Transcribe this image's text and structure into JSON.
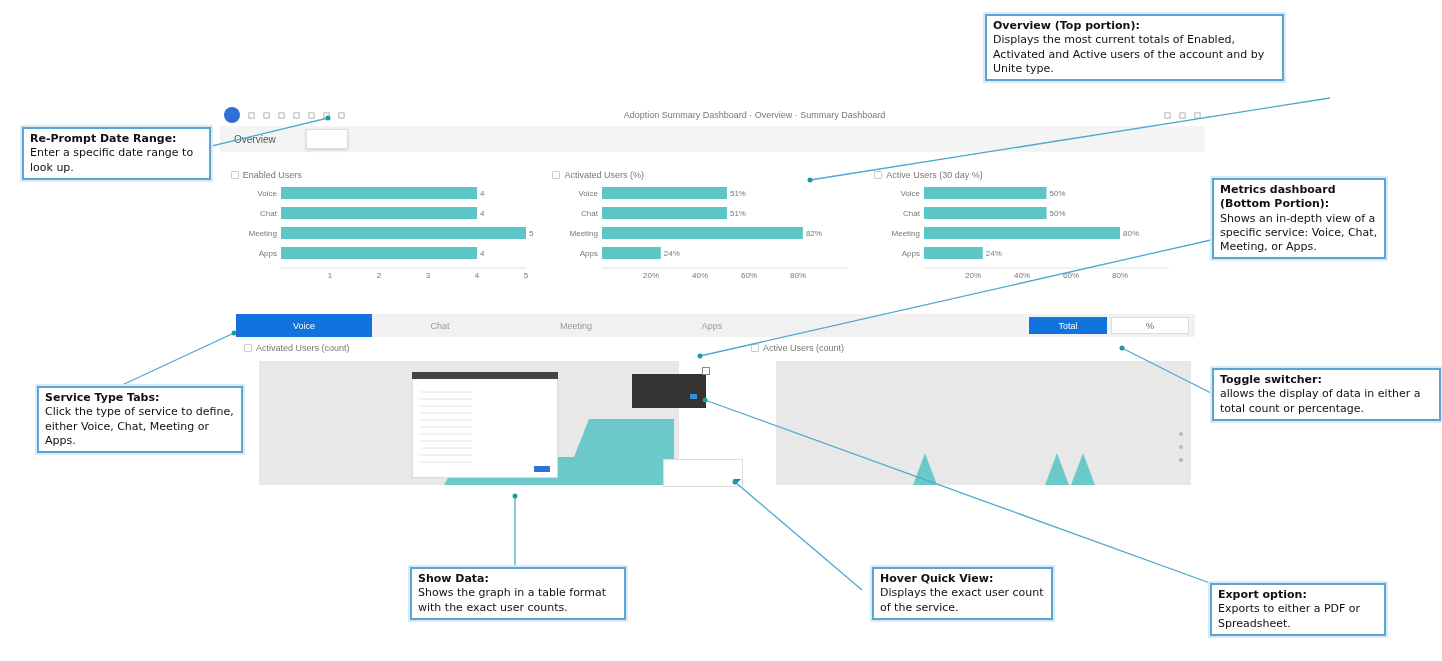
{
  "toolbar": {
    "title": "Adoption Summary Dashboard · Overview · Summary Dashboard"
  },
  "header": {
    "title": "Overview"
  },
  "overview_charts": [
    {
      "chart_data": {
        "type": "bar",
        "orientation": "horizontal",
        "title": "Enabled Users",
        "categories": [
          "Voice",
          "Chat",
          "Meeting",
          "Apps"
        ],
        "values": [
          4,
          4,
          5,
          4
        ],
        "xlim": [
          0,
          5
        ],
        "xticks": [
          1,
          2,
          3,
          4,
          5
        ],
        "data_labels": true
      }
    },
    {
      "chart_data": {
        "type": "bar",
        "orientation": "horizontal",
        "title": "Activated Users (%)",
        "categories": [
          "Voice",
          "Chat",
          "Meeting",
          "Apps"
        ],
        "values": [
          51,
          51,
          82,
          24
        ],
        "xlim": [
          0,
          100
        ],
        "xticks": [
          {
            "value": 20,
            "label": "20%"
          },
          {
            "value": 40,
            "label": "40%"
          },
          {
            "value": 60,
            "label": "60%"
          },
          {
            "value": 80,
            "label": "80%"
          }
        ],
        "value_labels": [
          "51%",
          "51%",
          "82%",
          "24%"
        ]
      }
    },
    {
      "chart_data": {
        "type": "bar",
        "orientation": "horizontal",
        "title": "Active Users (30 day %)",
        "categories": [
          "Voice",
          "Chat",
          "Meeting",
          "Apps"
        ],
        "values": [
          50,
          50,
          80,
          24
        ],
        "xlim": [
          0,
          100
        ],
        "xticks": [
          {
            "value": 20,
            "label": "20%"
          },
          {
            "value": 40,
            "label": "40%"
          },
          {
            "value": 60,
            "label": "60%"
          },
          {
            "value": 80,
            "label": "80%"
          }
        ],
        "value_labels": [
          "50%",
          "50%",
          "80%",
          "24%"
        ]
      }
    }
  ],
  "service_tabs": [
    {
      "label": "Voice",
      "selected": true
    },
    {
      "label": "Chat",
      "selected": false
    },
    {
      "label": "Meeting",
      "selected": false
    },
    {
      "label": "Apps",
      "selected": false
    }
  ],
  "toggle": [
    {
      "label": "Total",
      "selected": true
    },
    {
      "label": "%",
      "selected": false
    }
  ],
  "metric_charts": [
    {
      "title": "Activated Users (count)"
    },
    {
      "title": "Active Users (count)"
    }
  ],
  "callouts": [
    {
      "title": "Overview (Top portion):",
      "body": "Displays the most current totals of Enabled, Activated and Active users of the account and by Unite type."
    },
    {
      "title": "Re-Prompt Date Range:",
      "body": "Enter a specific date range to look up."
    },
    {
      "title": "Metrics dashboard (Bottom Portion):",
      "body": "Shows an in-depth view of a specific service: Voice, Chat, Meeting, or Apps."
    },
    {
      "title": "Service Type Tabs:",
      "body": "Click the type of service to define, either Voice, Chat, Meeting or Apps."
    },
    {
      "title": "Toggle switcher:",
      "body": "allows the display of data in either a total count or percentage."
    },
    {
      "title": "Show Data:",
      "body": "Shows the graph in a table format with the exact user counts."
    },
    {
      "title": "Hover Quick View:",
      "body": "Displays the exact user count of the service."
    },
    {
      "title": "Export option:",
      "body": "Exports to either a PDF or Spreadsheet."
    }
  ]
}
